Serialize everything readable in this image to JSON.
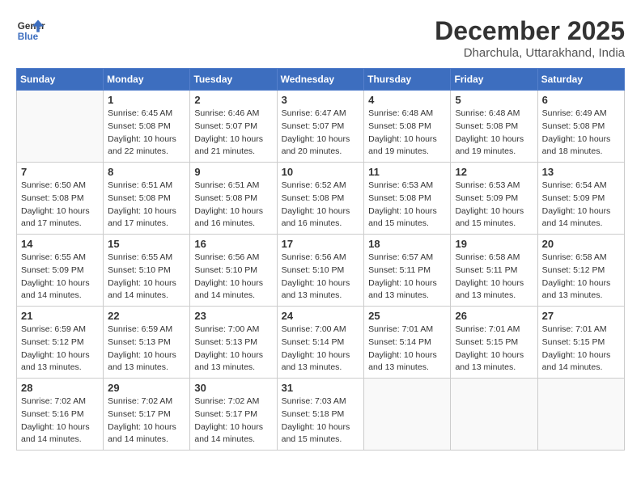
{
  "header": {
    "logo_line1": "General",
    "logo_line2": "Blue",
    "month_year": "December 2025",
    "location": "Dharchula, Uttarakhand, India"
  },
  "weekdays": [
    "Sunday",
    "Monday",
    "Tuesday",
    "Wednesday",
    "Thursday",
    "Friday",
    "Saturday"
  ],
  "weeks": [
    [
      {
        "day": "",
        "info": ""
      },
      {
        "day": "1",
        "info": "Sunrise: 6:45 AM\nSunset: 5:08 PM\nDaylight: 10 hours\nand 22 minutes."
      },
      {
        "day": "2",
        "info": "Sunrise: 6:46 AM\nSunset: 5:07 PM\nDaylight: 10 hours\nand 21 minutes."
      },
      {
        "day": "3",
        "info": "Sunrise: 6:47 AM\nSunset: 5:07 PM\nDaylight: 10 hours\nand 20 minutes."
      },
      {
        "day": "4",
        "info": "Sunrise: 6:48 AM\nSunset: 5:08 PM\nDaylight: 10 hours\nand 19 minutes."
      },
      {
        "day": "5",
        "info": "Sunrise: 6:48 AM\nSunset: 5:08 PM\nDaylight: 10 hours\nand 19 minutes."
      },
      {
        "day": "6",
        "info": "Sunrise: 6:49 AM\nSunset: 5:08 PM\nDaylight: 10 hours\nand 18 minutes."
      }
    ],
    [
      {
        "day": "7",
        "info": "Sunrise: 6:50 AM\nSunset: 5:08 PM\nDaylight: 10 hours\nand 17 minutes."
      },
      {
        "day": "8",
        "info": "Sunrise: 6:51 AM\nSunset: 5:08 PM\nDaylight: 10 hours\nand 17 minutes."
      },
      {
        "day": "9",
        "info": "Sunrise: 6:51 AM\nSunset: 5:08 PM\nDaylight: 10 hours\nand 16 minutes."
      },
      {
        "day": "10",
        "info": "Sunrise: 6:52 AM\nSunset: 5:08 PM\nDaylight: 10 hours\nand 16 minutes."
      },
      {
        "day": "11",
        "info": "Sunrise: 6:53 AM\nSunset: 5:08 PM\nDaylight: 10 hours\nand 15 minutes."
      },
      {
        "day": "12",
        "info": "Sunrise: 6:53 AM\nSunset: 5:09 PM\nDaylight: 10 hours\nand 15 minutes."
      },
      {
        "day": "13",
        "info": "Sunrise: 6:54 AM\nSunset: 5:09 PM\nDaylight: 10 hours\nand 14 minutes."
      }
    ],
    [
      {
        "day": "14",
        "info": "Sunrise: 6:55 AM\nSunset: 5:09 PM\nDaylight: 10 hours\nand 14 minutes."
      },
      {
        "day": "15",
        "info": "Sunrise: 6:55 AM\nSunset: 5:10 PM\nDaylight: 10 hours\nand 14 minutes."
      },
      {
        "day": "16",
        "info": "Sunrise: 6:56 AM\nSunset: 5:10 PM\nDaylight: 10 hours\nand 14 minutes."
      },
      {
        "day": "17",
        "info": "Sunrise: 6:56 AM\nSunset: 5:10 PM\nDaylight: 10 hours\nand 13 minutes."
      },
      {
        "day": "18",
        "info": "Sunrise: 6:57 AM\nSunset: 5:11 PM\nDaylight: 10 hours\nand 13 minutes."
      },
      {
        "day": "19",
        "info": "Sunrise: 6:58 AM\nSunset: 5:11 PM\nDaylight: 10 hours\nand 13 minutes."
      },
      {
        "day": "20",
        "info": "Sunrise: 6:58 AM\nSunset: 5:12 PM\nDaylight: 10 hours\nand 13 minutes."
      }
    ],
    [
      {
        "day": "21",
        "info": "Sunrise: 6:59 AM\nSunset: 5:12 PM\nDaylight: 10 hours\nand 13 minutes."
      },
      {
        "day": "22",
        "info": "Sunrise: 6:59 AM\nSunset: 5:13 PM\nDaylight: 10 hours\nand 13 minutes."
      },
      {
        "day": "23",
        "info": "Sunrise: 7:00 AM\nSunset: 5:13 PM\nDaylight: 10 hours\nand 13 minutes."
      },
      {
        "day": "24",
        "info": "Sunrise: 7:00 AM\nSunset: 5:14 PM\nDaylight: 10 hours\nand 13 minutes."
      },
      {
        "day": "25",
        "info": "Sunrise: 7:01 AM\nSunset: 5:14 PM\nDaylight: 10 hours\nand 13 minutes."
      },
      {
        "day": "26",
        "info": "Sunrise: 7:01 AM\nSunset: 5:15 PM\nDaylight: 10 hours\nand 13 minutes."
      },
      {
        "day": "27",
        "info": "Sunrise: 7:01 AM\nSunset: 5:15 PM\nDaylight: 10 hours\nand 14 minutes."
      }
    ],
    [
      {
        "day": "28",
        "info": "Sunrise: 7:02 AM\nSunset: 5:16 PM\nDaylight: 10 hours\nand 14 minutes."
      },
      {
        "day": "29",
        "info": "Sunrise: 7:02 AM\nSunset: 5:17 PM\nDaylight: 10 hours\nand 14 minutes."
      },
      {
        "day": "30",
        "info": "Sunrise: 7:02 AM\nSunset: 5:17 PM\nDaylight: 10 hours\nand 14 minutes."
      },
      {
        "day": "31",
        "info": "Sunrise: 7:03 AM\nSunset: 5:18 PM\nDaylight: 10 hours\nand 15 minutes."
      },
      {
        "day": "",
        "info": ""
      },
      {
        "day": "",
        "info": ""
      },
      {
        "day": "",
        "info": ""
      }
    ]
  ]
}
